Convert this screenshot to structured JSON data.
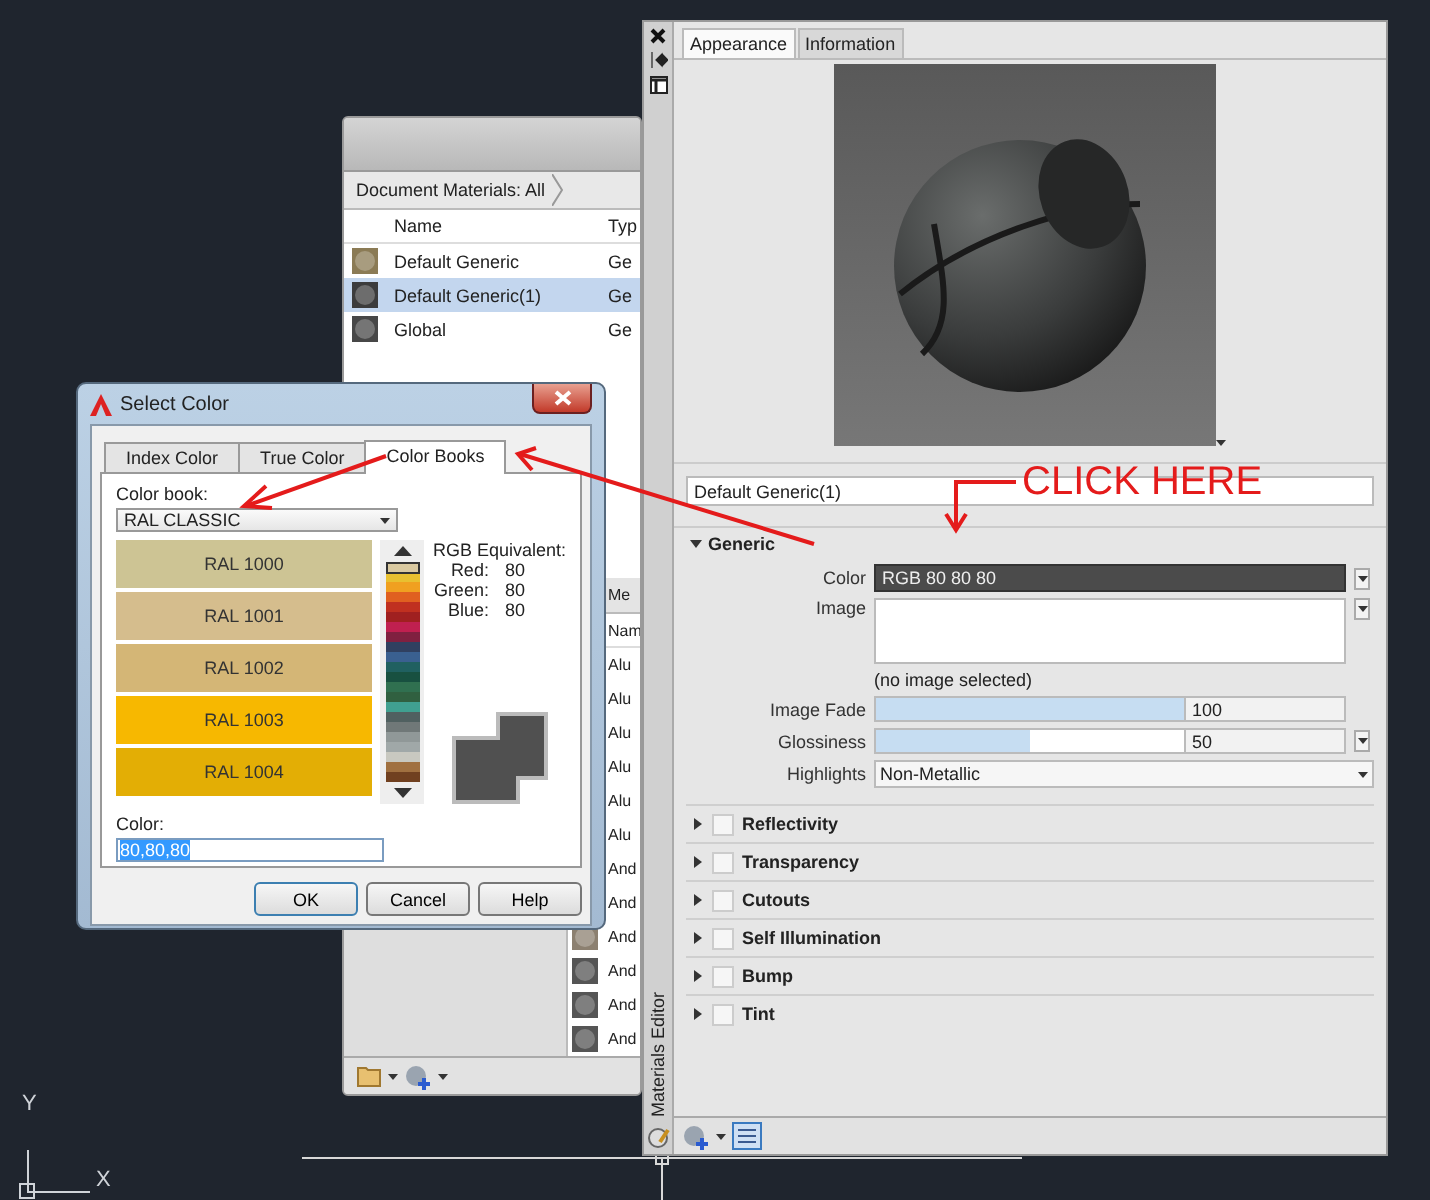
{
  "ucs": {
    "y_label": "Y",
    "x_label": "X"
  },
  "materials_browser": {
    "breadcrumb": "Document Materials: All",
    "columns": [
      "Name",
      "Typ"
    ],
    "rows": [
      {
        "name": "Default Generic",
        "type": "Ge",
        "selected": false
      },
      {
        "name": "Default Generic(1)",
        "type": "Ge",
        "selected": true
      },
      {
        "name": "Global",
        "type": "Ge",
        "selected": false
      }
    ],
    "library_tab": "Me",
    "library_column": "Nam",
    "library_rows": [
      "Alu",
      "Alu",
      "Alu",
      "Alu",
      "Alu",
      "Alu",
      "And",
      "And",
      "And",
      "And",
      "And",
      "And"
    ]
  },
  "materials_editor": {
    "title": "Materials Editor",
    "tabs": [
      {
        "label": "Appearance",
        "selected": true
      },
      {
        "label": "Information",
        "selected": false
      }
    ],
    "material_name": "Default Generic(1)",
    "generic": {
      "label": "Generic",
      "expanded": true,
      "color_label": "Color",
      "color_value": "RGB 80 80 80",
      "image_label": "Image",
      "image_note": "(no image selected)",
      "sliders": [
        {
          "label": "Image Fade",
          "level": 1,
          "reading": "100",
          "has_menu": false
        },
        {
          "label": "Glossiness",
          "level": 0.5,
          "reading": "50",
          "has_menu": true
        }
      ],
      "highlights_label": "Highlights",
      "highlights_value": "Non-Metallic"
    },
    "sections": [
      {
        "label": "Reflectivity",
        "expanded": false,
        "checked": false
      },
      {
        "label": "Transparency",
        "expanded": false,
        "checked": false
      },
      {
        "label": "Cutouts",
        "expanded": false,
        "checked": false
      },
      {
        "label": "Self Illumination",
        "expanded": false,
        "checked": false
      },
      {
        "label": "Bump",
        "expanded": false,
        "checked": false
      },
      {
        "label": "Tint",
        "expanded": false,
        "checked": false
      }
    ]
  },
  "select_color": {
    "title": "Select Color",
    "tabs": [
      {
        "label": "Index Color",
        "selected": false
      },
      {
        "label": "True Color",
        "selected": false
      },
      {
        "label": "Color Books",
        "selected": true
      }
    ],
    "color_book_label": "Color book:",
    "color_book": "RAL CLASSIC",
    "swatches": [
      {
        "label": "RAL 1000",
        "color": "#cdc494"
      },
      {
        "label": "RAL 1001",
        "color": "#d5bd8d"
      },
      {
        "label": "RAL 1002",
        "color": "#d4b676"
      },
      {
        "label": "RAL 1003",
        "color": "#f7b800"
      },
      {
        "label": "RAL 1004",
        "color": "#e3ae05"
      }
    ],
    "rgb_title": "RGB Equivalent:",
    "rgb": [
      {
        "label": "Red:",
        "value": "80"
      },
      {
        "label": "Green:",
        "value": "80"
      },
      {
        "label": "Blue:",
        "value": "80"
      }
    ],
    "color_label": "Color:",
    "color_value": "80,80,80",
    "buttons": [
      "OK",
      "Cancel",
      "Help"
    ]
  },
  "annotation": {
    "text": "CLICK HERE"
  }
}
